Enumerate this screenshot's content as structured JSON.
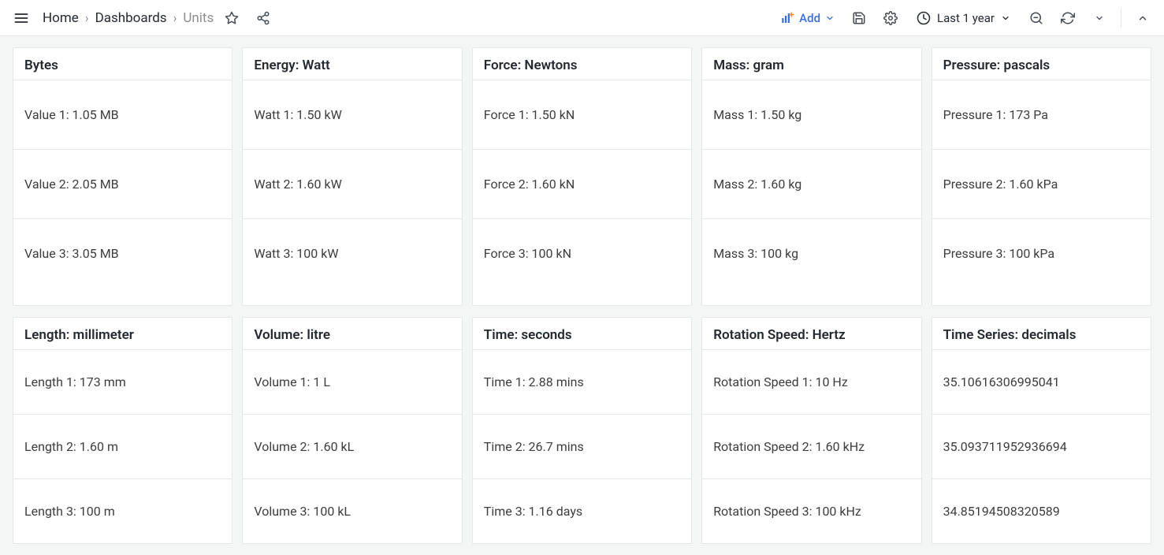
{
  "breadcrumb": {
    "home": "Home",
    "dashboards": "Dashboards",
    "current": "Units"
  },
  "toolbar": {
    "add_label": "Add",
    "time_label": "Last 1 year"
  },
  "panels_row1": [
    {
      "title": "Bytes",
      "r1": "Value 1: 1.05 MB",
      "r2": "Value 2: 2.05 MB",
      "r3": "Value 3: 3.05 MB"
    },
    {
      "title": "Energy: Watt",
      "r1": "Watt 1: 1.50 kW",
      "r2": "Watt 2: 1.60 kW",
      "r3": "Watt 3: 100 kW"
    },
    {
      "title": "Force: Newtons",
      "r1": "Force 1: 1.50 kN",
      "r2": "Force 2: 1.60 kN",
      "r3": "Force 3: 100 kN"
    },
    {
      "title": "Mass: gram",
      "r1": "Mass 1: 1.50 kg",
      "r2": "Mass 2: 1.60 kg",
      "r3": "Mass 3: 100 kg"
    },
    {
      "title": "Pressure: pascals",
      "r1": "Pressure 1: 173 Pa",
      "r2": "Pressure 2: 1.60 kPa",
      "r3": "Pressure 3: 100 kPa"
    }
  ],
  "panels_row2": [
    {
      "title": "Length: millimeter",
      "r1": "Length 1: 173 mm",
      "r2": "Length 2: 1.60 m",
      "r3": "Length 3: 100 m"
    },
    {
      "title": "Volume: litre",
      "r1": "Volume 1: 1 L",
      "r2": "Volume 2: 1.60 kL",
      "r3": "Volume 3: 100 kL"
    },
    {
      "title": "Time: seconds",
      "r1": "Time 1: 2.88 mins",
      "r2": "Time 2: 26.7 mins",
      "r3": "Time 3: 1.16 days"
    },
    {
      "title": "Rotation Speed: Hertz",
      "r1": "Rotation Speed 1: 10 Hz",
      "r2": "Rotation Speed 2: 1.60 kHz",
      "r3": "Rotation Speed 3: 100 kHz"
    },
    {
      "title": "Time Series: decimals",
      "r1": "35.10616306995041",
      "r2": "35.093711952936694",
      "r3": "34.85194508320589"
    }
  ]
}
